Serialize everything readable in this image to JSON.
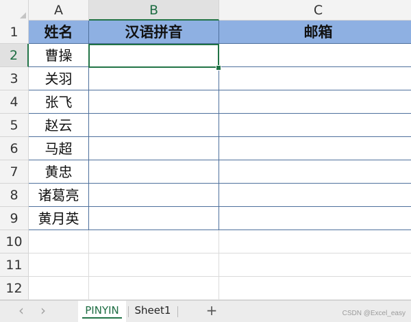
{
  "grid": {
    "columns": [
      {
        "id": "A",
        "label": "A",
        "active": false
      },
      {
        "id": "B",
        "label": "B",
        "active": true
      },
      {
        "id": "C",
        "label": "C",
        "active": false
      }
    ],
    "rows": [
      {
        "label": "1",
        "active": false,
        "cells": [
          "姓名",
          "汉语拼音",
          "邮箱"
        ]
      },
      {
        "label": "2",
        "active": true,
        "cells": [
          "曹操",
          "",
          ""
        ]
      },
      {
        "label": "3",
        "active": false,
        "cells": [
          "关羽",
          "",
          ""
        ]
      },
      {
        "label": "4",
        "active": false,
        "cells": [
          "张飞",
          "",
          ""
        ]
      },
      {
        "label": "5",
        "active": false,
        "cells": [
          "赵云",
          "",
          ""
        ]
      },
      {
        "label": "6",
        "active": false,
        "cells": [
          "马超",
          "",
          ""
        ]
      },
      {
        "label": "7",
        "active": false,
        "cells": [
          "黄忠",
          "",
          ""
        ]
      },
      {
        "label": "8",
        "active": false,
        "cells": [
          "诸葛亮",
          "",
          ""
        ]
      },
      {
        "label": "9",
        "active": false,
        "cells": [
          "黄月英",
          "",
          ""
        ]
      },
      {
        "label": "10",
        "active": false,
        "cells": [
          "",
          "",
          ""
        ]
      },
      {
        "label": "11",
        "active": false,
        "cells": [
          "",
          "",
          ""
        ]
      },
      {
        "label": "12",
        "active": false,
        "cells": [
          "",
          "",
          ""
        ]
      }
    ],
    "selected_cell": "B2",
    "header_fill_color": "#8eb0e2",
    "accent_color": "#217346",
    "border_color": "#4d6f9c"
  },
  "sheet_tabs": {
    "prev_glyph": "‹",
    "next_glyph": "›",
    "tabs": [
      {
        "label": "PINYIN",
        "active": true
      },
      {
        "label": "Sheet1",
        "active": false
      }
    ],
    "add_glyph": "+"
  },
  "watermark": "CSDN @Excel_easy"
}
